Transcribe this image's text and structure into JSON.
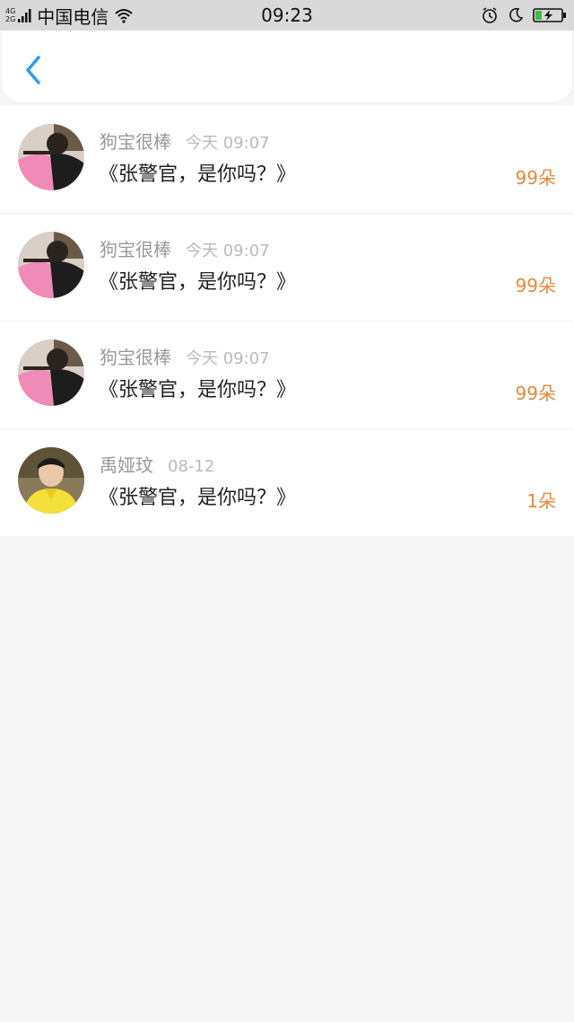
{
  "status_bar": {
    "net_top": "4G",
    "net_bottom": "2G",
    "carrier": "中国电信",
    "time": "09:23",
    "icons": [
      "signal-icon",
      "wifi-icon",
      "alarm-icon",
      "moon-icon",
      "battery-charging-icon"
    ]
  },
  "nav": {
    "back_icon": "chevron-left-icon",
    "accent_color": "#2f9cf0"
  },
  "list": {
    "items": [
      {
        "name": "狗宝很棒",
        "time": "今天 09:07",
        "message": "《张警官，是你吗？》",
        "count": "99朵",
        "avatar": "pink-shirt-avatar"
      },
      {
        "name": "狗宝很棒",
        "time": "今天 09:07",
        "message": "《张警官，是你吗？》",
        "count": "99朵",
        "avatar": "pink-shirt-avatar"
      },
      {
        "name": "狗宝很棒",
        "time": "今天 09:07",
        "message": "《张警官，是你吗？》",
        "count": "99朵",
        "avatar": "pink-shirt-avatar"
      },
      {
        "name": "禹娅玟",
        "time": "08-12",
        "message": "《张警官，是你吗？》",
        "count": "1朵",
        "avatar": "yellow-jacket-avatar"
      }
    ]
  },
  "colors": {
    "count_orange": "#e8873a",
    "name_gray": "#999999",
    "time_gray": "#bbbbbb",
    "status_bar_bg": "#d9d9d9",
    "page_bg": "#f6f6f6"
  }
}
